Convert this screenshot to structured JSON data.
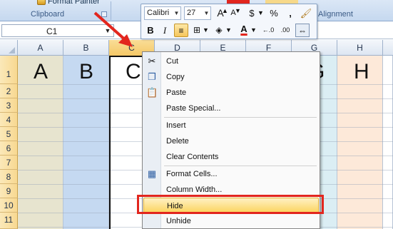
{
  "ribbon": {
    "format_painter_label": "Format Painter",
    "clipboard_group_label": "Clipboard",
    "alignment_group_label": "Alignment"
  },
  "name_box": {
    "value": "C1"
  },
  "columns": [
    "A",
    "B",
    "C",
    "D",
    "E",
    "F",
    "G",
    "H"
  ],
  "selected_column": "C",
  "rows": [
    "1",
    "2",
    "3",
    "4",
    "5",
    "6",
    "7",
    "8",
    "9",
    "10",
    "11"
  ],
  "cell_values": {
    "A1": "A",
    "B1": "B",
    "C1": "C",
    "G1": "G",
    "H1": "H"
  },
  "column_colors": {
    "A": "#e7e4cf",
    "B": "#c5d9f1",
    "C": "#ffffff",
    "D": "#ffffff",
    "E": "#ffffff",
    "F": "#ffffff",
    "G": "#dbeef4",
    "H": "#fde9d9"
  },
  "mini_toolbar": {
    "font_name": "Calibri",
    "font_size": "27",
    "grow_font": "A",
    "shrink_font": "A",
    "currency": "$",
    "percent": "%",
    "comma": ",",
    "bold": "B",
    "italic": "I",
    "font_color_letter": "A",
    "increase_decimal": "←.0",
    "decrease_decimal": ".00"
  },
  "context_menu": {
    "items": [
      {
        "label": "Cut",
        "icon": "scissors-icon"
      },
      {
        "label": "Copy",
        "icon": "copy-icon"
      },
      {
        "label": "Paste",
        "icon": "paste-icon"
      },
      {
        "label": "Paste Special...",
        "icon": ""
      },
      {
        "label": "Insert",
        "icon": ""
      },
      {
        "label": "Delete",
        "icon": ""
      },
      {
        "label": "Clear Contents",
        "icon": ""
      },
      {
        "label": "Format Cells...",
        "icon": "format-cells-icon"
      },
      {
        "label": "Column Width...",
        "icon": ""
      },
      {
        "label": "Hide",
        "icon": "",
        "highlighted": true
      },
      {
        "label": "Unhide",
        "icon": ""
      }
    ]
  },
  "colors": {
    "highlight_box": "#e2261e",
    "arrow": "#e2261e",
    "font_color_bar": "#e2261e"
  }
}
